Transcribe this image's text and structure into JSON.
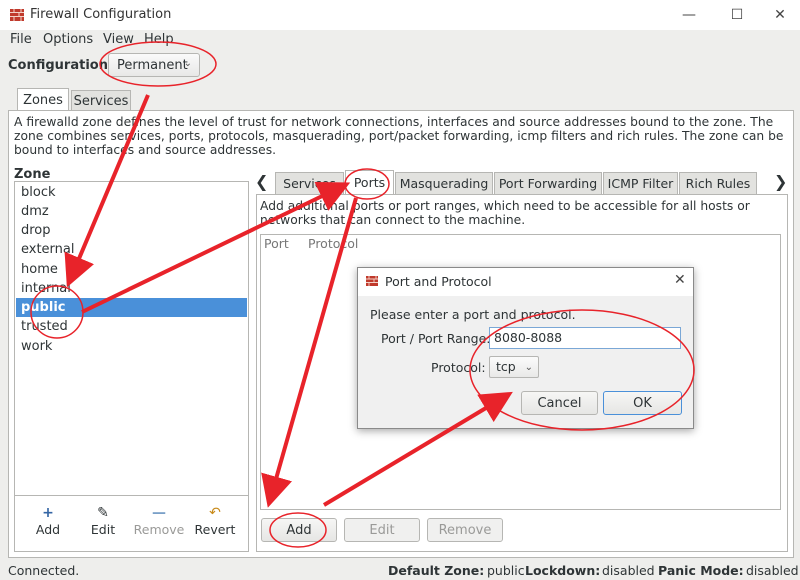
{
  "window": {
    "title": "Firewall Configuration",
    "minimize": "—",
    "maximize": "☐",
    "close": "✕"
  },
  "menu": [
    "File",
    "Options",
    "View",
    "Help"
  ],
  "configuration": {
    "label": "Configuration:",
    "value": "Permanent"
  },
  "main_tabs": [
    {
      "label": "Zones",
      "active": true
    },
    {
      "label": "Services",
      "active": false
    }
  ],
  "zone_description": "A firewalld zone defines the level of trust for network connections, interfaces and source addresses bound to the zone. The zone combines services, ports, protocols, masquerading, port/packet forwarding, icmp filters and rich rules. The zone can be bound to interfaces and source addresses.",
  "zone_heading": "Zone",
  "zones": [
    "block",
    "dmz",
    "drop",
    "external",
    "home",
    "internal",
    "public",
    "trusted",
    "work"
  ],
  "selected_zone": "public",
  "zone_tools": [
    {
      "label": "Add",
      "icon": "plus-icon",
      "enabled": true
    },
    {
      "label": "Edit",
      "icon": "edit-icon",
      "enabled": true
    },
    {
      "label": "Remove",
      "icon": "minus-icon",
      "enabled": false
    },
    {
      "label": "Revert",
      "icon": "revert-icon",
      "enabled": true
    }
  ],
  "sub_tabs": [
    {
      "label": "Services",
      "active": false
    },
    {
      "label": "Ports",
      "active": true
    },
    {
      "label": "Masquerading",
      "active": false
    },
    {
      "label": "Port Forwarding",
      "active": false
    },
    {
      "label": "ICMP Filter",
      "active": false
    },
    {
      "label": "Rich Rules",
      "active": false
    }
  ],
  "ports": {
    "description": "Add additional ports or port ranges, which need to be accessible for all hosts or networks that can connect to the machine.",
    "columns": [
      "Port",
      "Protocol"
    ],
    "buttons": [
      {
        "label": "Add",
        "enabled": true
      },
      {
        "label": "Edit",
        "enabled": false
      },
      {
        "label": "Remove",
        "enabled": false
      }
    ]
  },
  "dialog": {
    "title": "Port and Protocol",
    "prompt": "Please enter a port and protocol.",
    "port_label": "Port / Port Range:",
    "port_value": "8080-8088",
    "protocol_label": "Protocol:",
    "protocol_value": "tcp",
    "cancel": "Cancel",
    "ok": "OK"
  },
  "status": {
    "connection": "Connected.",
    "default_zone_label": "Default Zone:",
    "default_zone_value": "public",
    "lockdown_label": "Lockdown:",
    "lockdown_value": "disabled",
    "panic_label": "Panic Mode:",
    "panic_value": "disabled"
  },
  "colors": {
    "selection": "#4a90d9",
    "annotation": "#e8232a"
  }
}
